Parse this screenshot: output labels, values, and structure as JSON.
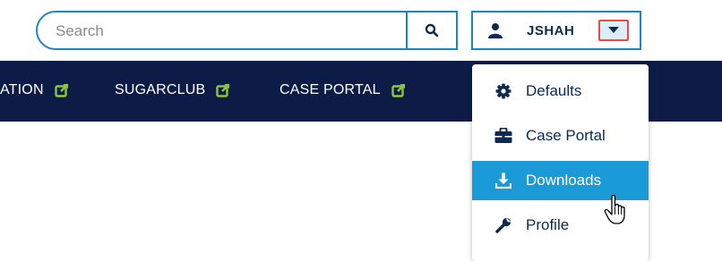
{
  "search": {
    "placeholder": "Search"
  },
  "user": {
    "name": "JSHAH"
  },
  "nav": {
    "items": [
      {
        "label": "ATION"
      },
      {
        "label": "SUGARCLUB"
      },
      {
        "label": "CASE PORTAL"
      }
    ]
  },
  "dropdown": {
    "items": [
      {
        "label": "Defaults",
        "icon": "gear-icon"
      },
      {
        "label": "Case Portal",
        "icon": "briefcase-icon"
      },
      {
        "label": "Downloads",
        "icon": "download-icon",
        "active": true
      },
      {
        "label": "Profile",
        "icon": "wrench-icon"
      }
    ]
  },
  "colors": {
    "accent": "#1a86c2",
    "nav_bg": "#0c1c46",
    "external_link": "#8cc63f",
    "highlight": "#1a9ad6",
    "caret_border": "#e84c3d"
  }
}
